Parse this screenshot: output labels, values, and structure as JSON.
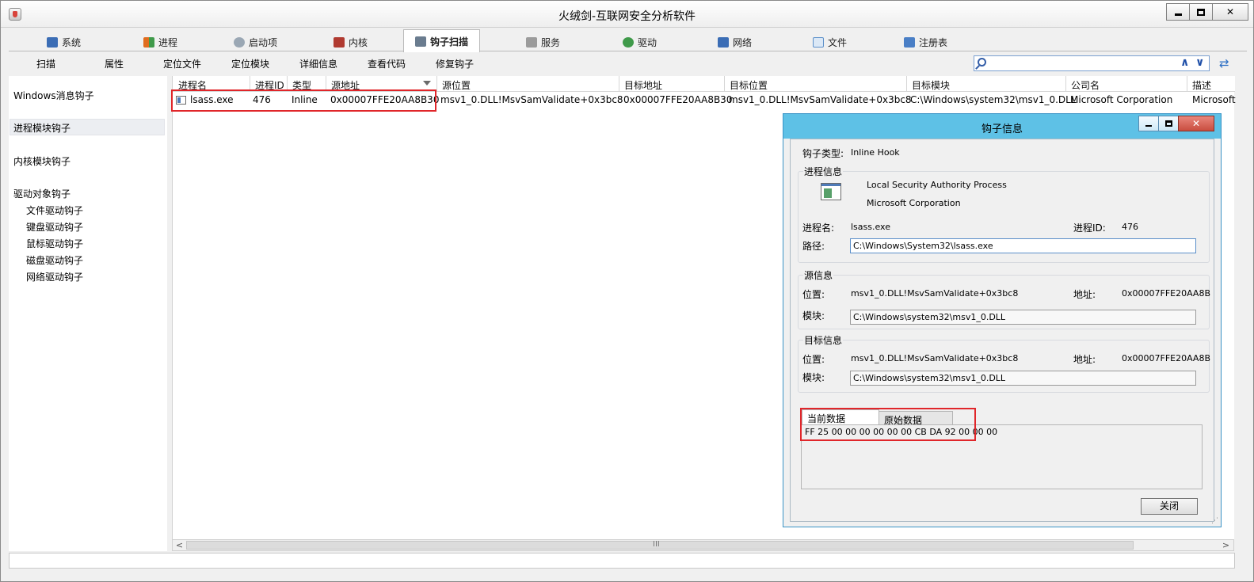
{
  "window": {
    "title": "火绒剑-互联网安全分析软件"
  },
  "tabs": [
    {
      "label": "系统",
      "icon": "monitor-icon",
      "color": "#3b6db5"
    },
    {
      "label": "进程",
      "icon": "windows-flag-icon",
      "color": "#e06c1e"
    },
    {
      "label": "启动项",
      "icon": "gear-icon",
      "color": "#6a7c8f"
    },
    {
      "label": "内核",
      "icon": "kernel-icon",
      "color": "#b03a30"
    },
    {
      "label": "钩子扫描",
      "icon": "hook-icon",
      "color": "#6a7c8f"
    },
    {
      "label": "服务",
      "icon": "service-icon",
      "color": "#8b8b8b"
    },
    {
      "label": "驱动",
      "icon": "driver-icon",
      "color": "#3f9a4a"
    },
    {
      "label": "网络",
      "icon": "network-icon",
      "color": "#3b6db5"
    },
    {
      "label": "文件",
      "icon": "file-icon",
      "color": "#5b8fc9"
    },
    {
      "label": "注册表",
      "icon": "registry-icon",
      "color": "#4a7fc6"
    }
  ],
  "toolbar": {
    "buttons": [
      "扫描",
      "属性",
      "定位文件",
      "定位模块",
      "详细信息",
      "查看代码",
      "修复钩子"
    ],
    "search_value": ""
  },
  "sidebar": {
    "items": [
      {
        "label": "Windows消息钩子"
      },
      {
        "label": "进程模块钩子",
        "selected": true
      },
      {
        "label": "内核模块钩子"
      },
      {
        "label": "驱动对象钩子"
      }
    ],
    "subitems": [
      "文件驱动钩子",
      "键盘驱动钩子",
      "鼠标驱动钩子",
      "磁盘驱动钩子",
      "网络驱动钩子"
    ]
  },
  "table": {
    "columns": [
      "进程名",
      "进程ID",
      "类型",
      "源地址",
      "源位置",
      "目标地址",
      "目标位置",
      "目标模块",
      "公司名",
      "描述"
    ],
    "rows": [
      [
        "lsass.exe",
        "476",
        "Inline",
        "0x00007FFE20AA8B30",
        "msv1_0.DLL!MsvSamValidate+0x3bc8",
        "0x00007FFE20AA8B30",
        "msv1_0.DLL!MsvSamValidate+0x3bc8",
        "C:\\Windows\\system32\\msv1_0.DLL",
        "Microsoft Corporation",
        "Microsoft"
      ]
    ],
    "scroll_grip": "III"
  },
  "dialog": {
    "title": "钩子信息",
    "hook_type_label": "钩子类型:",
    "hook_type_value": "Inline Hook",
    "process_group": "进程信息",
    "process_desc": "Local Security Authority Process",
    "process_company": "Microsoft Corporation",
    "proc_name_label": "进程名:",
    "proc_name_value": "lsass.exe",
    "pid_label": "进程ID:",
    "pid_value": "476",
    "path_label": "路径:",
    "path_value": "C:\\Windows\\System32\\lsass.exe",
    "source_group": "源信息",
    "src_location_label": "位置:",
    "src_location_value": "msv1_0.DLL!MsvSamValidate+0x3bc8",
    "src_address_label": "地址:",
    "src_address_value": "0x00007FFE20AA8B",
    "src_module_label": "模块:",
    "src_module_value": "C:\\Windows\\system32\\msv1_0.DLL",
    "target_group": "目标信息",
    "tgt_location_label": "位置:",
    "tgt_location_value": "msv1_0.DLL!MsvSamValidate+0x3bc8",
    "tgt_address_label": "地址:",
    "tgt_address_value": "0x00007FFE20AA8B",
    "tgt_module_label": "模块:",
    "tgt_module_value": "C:\\Windows\\system32\\msv1_0.DLL",
    "data_tabs": [
      "当前数据",
      "原始数据"
    ],
    "current_data": "FF 25 00 00 00 00 00 00 CB DA 92 00 00 00",
    "close_label": "关闭"
  },
  "colors": {
    "highlight_box": "#e0262a",
    "dialog_title": "#5ec1e6",
    "close_button": "#c94d3f"
  }
}
